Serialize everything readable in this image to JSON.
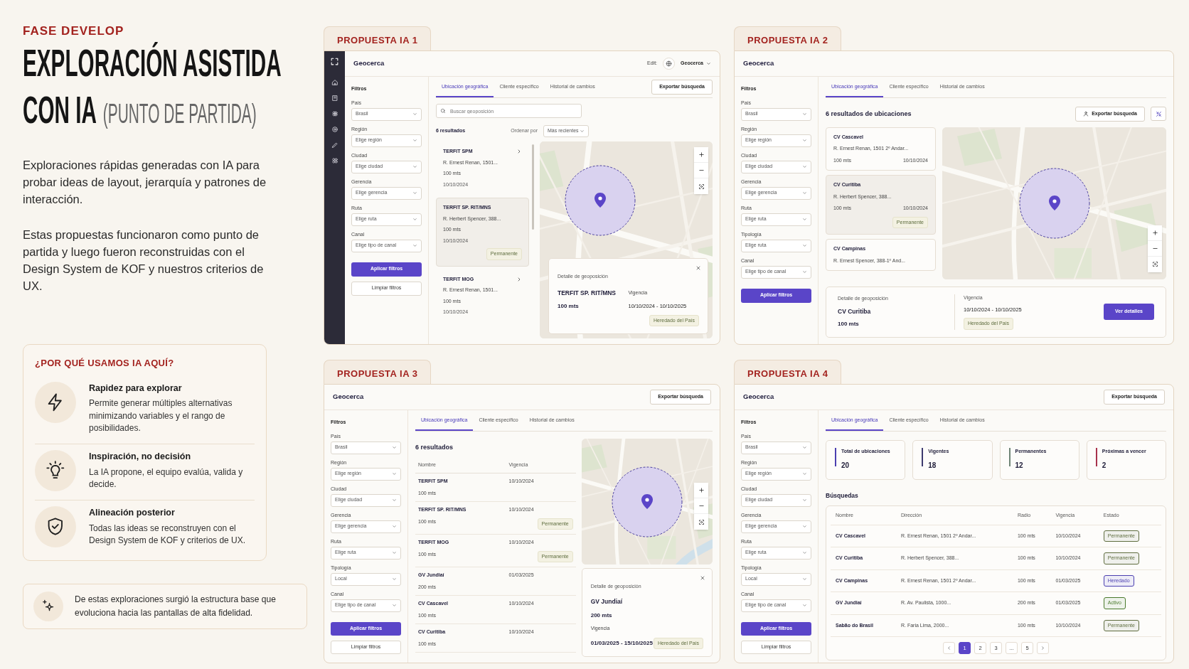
{
  "intro": {
    "eyebrow": "FASE DEVELOP",
    "title_lines": [
      "EXPLORACIÓN ASISTIDA",
      "CON IA"
    ],
    "subtitle": "(PUNTO DE PARTIDA)",
    "paragraphs": [
      "Exploraciones rápidas generadas con IA para probar ideas de layout, jerarquía y patrones de interacción.",
      "Estas propuestas funcionaron como punto de partida y luego fueron reconstruidas con el Design System de KOF y nuestros criterios de UX."
    ]
  },
  "why_card": {
    "title": "¿POR QUÉ USAMOS IA AQUÍ?",
    "items": [
      {
        "kind": "bolt",
        "title": "Rapidez para explorar",
        "text": "Permite generar múltiples alternativas minimizando variables y el rango de posibilidades."
      },
      {
        "kind": "bulb",
        "title": "Inspiración, no decisión",
        "text": "La IA propone, el equipo evalúa, valida y decide."
      },
      {
        "kind": "shield",
        "title": "Alineación posterior",
        "text": "Todas las ideas se reconstruyen con el Design System de KOF y criterios de UX."
      }
    ]
  },
  "note": {
    "text": "De estas exploraciones surgió la estructura base que evoluciona hacia las pantallas de alta fidelidad."
  },
  "proposals": [
    {
      "label": "PROPUESTA IA 1",
      "rail": true,
      "title": "Geocerca",
      "header_menu": {
        "prefix": "Edit:",
        "value": "Geocerca"
      },
      "filters": {
        "title": "Filtros",
        "fields": [
          {
            "label": "País",
            "value": "Brasil"
          },
          {
            "label": "Región",
            "value": "Elige región"
          },
          {
            "label": "Ciudad",
            "value": "Elige ciudad"
          },
          {
            "label": "Gerencia",
            "value": "Elige gerencia"
          },
          {
            "label": "Ruta",
            "value": "Elige ruta"
          },
          {
            "label": "Canal",
            "value": "Elige tipo de canal"
          }
        ],
        "apply": "Aplicar filtros",
        "clear": "Limpiar filtros"
      },
      "tabs": [
        {
          "label": "Ubicación geográfica",
          "selected": true
        },
        {
          "label": "Cliente específico",
          "selected": false
        },
        {
          "label": "Historial de cambios",
          "selected": false
        }
      ],
      "tabs_export": "Exportar búsqueda",
      "content": {
        "kind": "list_map",
        "search_placeholder": "Buscar geoposición",
        "count": "6 resultados",
        "sort_label": "Ordenar por",
        "sort_value": "Más recientes",
        "chevrons": true,
        "results": [
          {
            "name": "TERFIT SPM",
            "address": "R. Ernest Renan, 1501...",
            "radius": "100 mts",
            "date": "10/10/2024",
            "selected": false
          },
          {
            "name": "TERFIT SP. RIT/MNS",
            "address": "R. Herbert Spencer, 388...",
            "radius": "100 mts",
            "date": "10/10/2024",
            "badge": "Permanente",
            "selected": true
          },
          {
            "name": "TERFIT MOG",
            "address": "R. Ernest Renan, 1501...",
            "radius": "100 mts",
            "date": "10/10/2024",
            "selected": false
          }
        ],
        "detail": {
          "caption": "Detalle de geoposición",
          "name": "TERFIT SP. RIT/MNS",
          "radius": "100 mts",
          "validity_label": "Vigencia",
          "validity": "10/10/2024 - 10/10/2025",
          "badge": "Heredado del País",
          "closable": true
        }
      }
    },
    {
      "label": "PROPUESTA IA 2",
      "rail": false,
      "title": "Geocerca",
      "filters": {
        "title": "Filtros",
        "fields": [
          {
            "label": "País",
            "value": "Brasil"
          },
          {
            "label": "Región",
            "value": "Elige región"
          },
          {
            "label": "Ciudad",
            "value": "Elige ciudad"
          },
          {
            "label": "Gerencia",
            "value": "Elige gerencia"
          },
          {
            "label": "Ruta",
            "value": "Elige ruta"
          },
          {
            "label": "Tipología",
            "value": "Elige ruta"
          },
          {
            "label": "Canal",
            "value": "Elige tipo de canal"
          }
        ],
        "apply": "Aplicar filtros"
      },
      "tabs": [
        {
          "label": "Ubicación geográfica",
          "selected": true
        },
        {
          "label": "Cliente específico",
          "selected": false
        },
        {
          "label": "Historial de cambios",
          "selected": false
        }
      ],
      "content": {
        "kind": "cards_map",
        "heading": "6 resultados de ubicaciones",
        "export": "Exportar búsqueda",
        "results": [
          {
            "name": "CV Cascavel",
            "address": "R. Ernest Renan, 1501 2º Andar...",
            "radius": "100 mts",
            "date": "10/10/2024",
            "selected": false
          },
          {
            "name": "CV Curitiba",
            "address": "R. Herbert Spencer, 388...",
            "radius": "100 mts",
            "date": "10/10/2024",
            "badge": "Permanente",
            "selected": true
          },
          {
            "name": "CV Campinas",
            "address": "R. Ernest Spencer, 388-1º And...",
            "selected": false
          }
        ],
        "detail": {
          "caption": "Detalle de geoposición",
          "name": "CV Curitiba",
          "radius": "100 mts",
          "validity_label": "Vigencia",
          "validity": "10/10/2024 - 10/10/2025",
          "badge": "Heredado del País",
          "action": "Ver detalles"
        }
      }
    },
    {
      "label": "PROPUESTA IA 3",
      "rail": false,
      "title": "Geocerca",
      "header_export": "Exportar búsqueda",
      "filters": {
        "title": "Filtros",
        "fields": [
          {
            "label": "País",
            "value": "Brasil"
          },
          {
            "label": "Región",
            "value": "Elige región"
          },
          {
            "label": "Ciudad",
            "value": "Elige ciudad"
          },
          {
            "label": "Gerencia",
            "value": "Elige gerencia"
          },
          {
            "label": "Ruta",
            "value": "Elige ruta"
          },
          {
            "label": "Tipología",
            "value": "Local"
          },
          {
            "label": "Canal",
            "value": "Elige tipo de canal"
          }
        ],
        "apply": "Aplicar filtros",
        "clear": "Limpiar filtros"
      },
      "tabs": [
        {
          "label": "Ubicación geográfica",
          "selected": true
        },
        {
          "label": "Cliente específico",
          "selected": false
        },
        {
          "label": "Historial de cambios",
          "selected": false
        }
      ],
      "content": {
        "kind": "table_map",
        "count": "6 resultados",
        "columns": [
          "Nombre",
          "Vigencia"
        ],
        "rows": [
          {
            "name": "TERFIT SPM",
            "radius": "100 mts",
            "date": "10/10/2024"
          },
          {
            "name": "TERFIT SP. RIT/MNS",
            "radius": "100 mts",
            "date": "10/10/2024",
            "badge": "Permanente"
          },
          {
            "name": "TERFIT MOG",
            "radius": "100 mts",
            "date": "10/10/2024",
            "badge": "Permanente"
          },
          {
            "name": "GV Jundiaí",
            "radius": "200 mts",
            "date": "01/03/2025"
          },
          {
            "name": "CV Cascavel",
            "radius": "100 mts",
            "date": "10/10/2024"
          },
          {
            "name": "CV Curitiba",
            "radius": "100 mts",
            "date": "10/10/2024"
          }
        ],
        "detail": {
          "caption": "Detalle de geoposición",
          "name": "GV Jundiaí",
          "radius": "200 mts",
          "validity_label": "Vigencia",
          "validity": "01/03/2025 - 15/10/2025",
          "badge": "Heredado del País",
          "closable": true
        }
      }
    },
    {
      "label": "PROPUESTA IA 4",
      "rail": false,
      "title": "Geocerca",
      "header_export": "Exportar búsqueda",
      "filters": {
        "title": "Filtros",
        "fields": [
          {
            "label": "País",
            "value": "Brasil"
          },
          {
            "label": "Región",
            "value": "Elige región"
          },
          {
            "label": "Ciudad",
            "value": "Elige ciudad"
          },
          {
            "label": "Gerencia",
            "value": "Elige gerencia"
          },
          {
            "label": "Ruta",
            "value": "Elige ruta"
          },
          {
            "label": "Tipología",
            "value": "Local"
          },
          {
            "label": "Canal",
            "value": "Elige tipo de canal"
          }
        ],
        "apply": "Aplicar filtros",
        "clear": "Limpiar filtros"
      },
      "tabs": [
        {
          "label": "Ubicación geográfica",
          "selected": true
        },
        {
          "label": "Cliente específico",
          "selected": false
        },
        {
          "label": "Historial de cambios",
          "selected": false
        }
      ],
      "content": {
        "kind": "dashboard",
        "kpis": [
          {
            "label": "Total de ubicaciones",
            "value": "20",
            "color": "#4b3fb0"
          },
          {
            "label": "Vigentes",
            "value": "18",
            "color": "#3d3a6e"
          },
          {
            "label": "Permanentes",
            "value": "12",
            "color": "#6f8576"
          },
          {
            "label": "Próximas a vencer",
            "value": "2",
            "color": "#a8324c"
          }
        ],
        "section_title": "Búsquedas",
        "columns": [
          "Nombre",
          "Dirección",
          "Radio",
          "Vigencia",
          "Estado"
        ],
        "rows": [
          {
            "cells": [
              "CV Cascavel",
              "R. Ernest Renan, 1501 2º Andar...",
              "100 mts",
              "10/10/2024"
            ],
            "status": {
              "label": "Permanente",
              "color": "#5f6d3f"
            }
          },
          {
            "cells": [
              "CV Curitiba",
              "R. Herbert Spencer, 388...",
              "100 mts",
              "10/10/2024"
            ],
            "status": {
              "label": "Permanente",
              "color": "#5f6d3f"
            }
          },
          {
            "cells": [
              "CV Campinas",
              "R. Ernest Renan, 1501 2º Andar...",
              "100 mts",
              "01/03/2025"
            ],
            "status": {
              "label": "Heredado",
              "color": "#4b3fb0"
            }
          },
          {
            "cells": [
              "GV Jundiaí",
              "R. Av. Paulista, 1000...",
              "200 mts",
              "01/03/2025"
            ],
            "status": {
              "label": "Activo",
              "color": "#4a7a2c"
            }
          },
          {
            "cells": [
              "Sabão do Brasil",
              "R. Faria Lima, 2000...",
              "100 mts",
              "10/10/2024"
            ],
            "status": {
              "label": "Permanente",
              "color": "#5f6d3f"
            }
          }
        ],
        "pages": [
          {
            "label": "1",
            "selected": true
          },
          {
            "label": "2",
            "selected": false
          },
          {
            "label": "3",
            "selected": false
          },
          {
            "label": "...",
            "selected": false
          },
          {
            "label": "5",
            "selected": false
          }
        ]
      }
    }
  ]
}
